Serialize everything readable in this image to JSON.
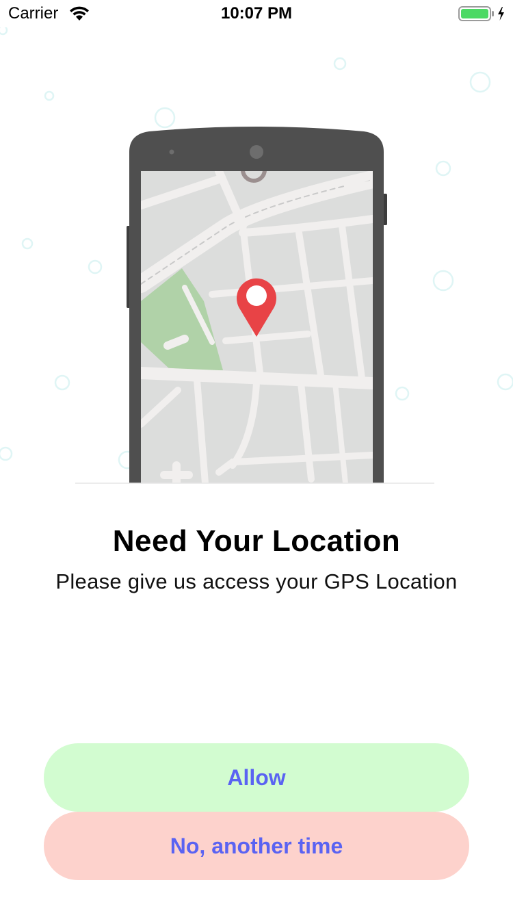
{
  "status_bar": {
    "carrier": "Carrier",
    "time": "10:07 PM",
    "wifi_icon": "wifi-icon",
    "battery_icon": "battery-icon",
    "charging_icon": "lightning-icon",
    "battery_color": "#4cd964"
  },
  "illustration": {
    "icon": "phone-map-illustration",
    "pin_icon": "location-pin-icon",
    "pin_color": "#e84346",
    "park_color": "#b0d2a8",
    "phone_color": "#4f4f4f",
    "bubble_color": "#dff5f5"
  },
  "permission": {
    "title": "Need Your Location",
    "subtitle": "Please give us access your GPS Location"
  },
  "actions": {
    "allow_label": "Allow",
    "deny_label": "No, another time",
    "allow_bg": "#d2fcd0",
    "deny_bg": "#fdd2cc",
    "label_color": "#5a63f2"
  }
}
